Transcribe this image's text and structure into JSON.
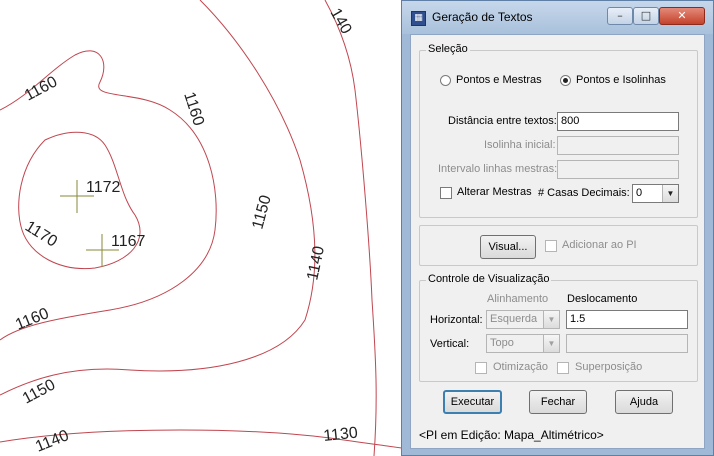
{
  "map": {
    "labels": [
      "140",
      "1160",
      "1160",
      "1172",
      "1167",
      "1170",
      "1150",
      "1140",
      "1160",
      "1150",
      "1140",
      "1130"
    ],
    "line_color": "#c0464f",
    "marker_color": "#8a8a3a"
  },
  "window": {
    "title": "Geração de Textos",
    "controls": {
      "minimize": "–",
      "maximize": "□",
      "close": "✕"
    }
  },
  "selecao": {
    "title": "Seleção",
    "radio1_label": "Pontos e Mestras",
    "radio2_label": "Pontos e Isolinhas",
    "selected": "Pontos e Isolinhas",
    "distancia_label": "Distância entre textos:",
    "distancia_value": "800",
    "isolinha_label": "Isolinha inicial:",
    "isolinha_value": "",
    "intervalo_label": "Intervalo linhas mestras:",
    "intervalo_value": "",
    "alterar_label": "Alterar Mestras",
    "casas_label": "# Casas Decimais:",
    "casas_value": "0"
  },
  "visual": {
    "button_label": "Visual...",
    "adicionar_label": "Adicionar ao PI"
  },
  "controle": {
    "title": "Controle de Visualização",
    "col_alinhamento": "Alinhamento",
    "col_deslocamento": "Deslocamento",
    "horizontal_label": "Horizontal:",
    "horizontal_align": "Esquerda",
    "horizontal_desloc": "1.5",
    "vertical_label": "Vertical:",
    "vertical_align": "Topo",
    "vertical_desloc": "",
    "otimizacao_label": "Otimização",
    "superposicao_label": "Superposição"
  },
  "actions": {
    "executar": "Executar",
    "fechar": "Fechar",
    "ajuda": "Ajuda"
  },
  "status": "<PI em Edição: Mapa_Altimétrico>"
}
